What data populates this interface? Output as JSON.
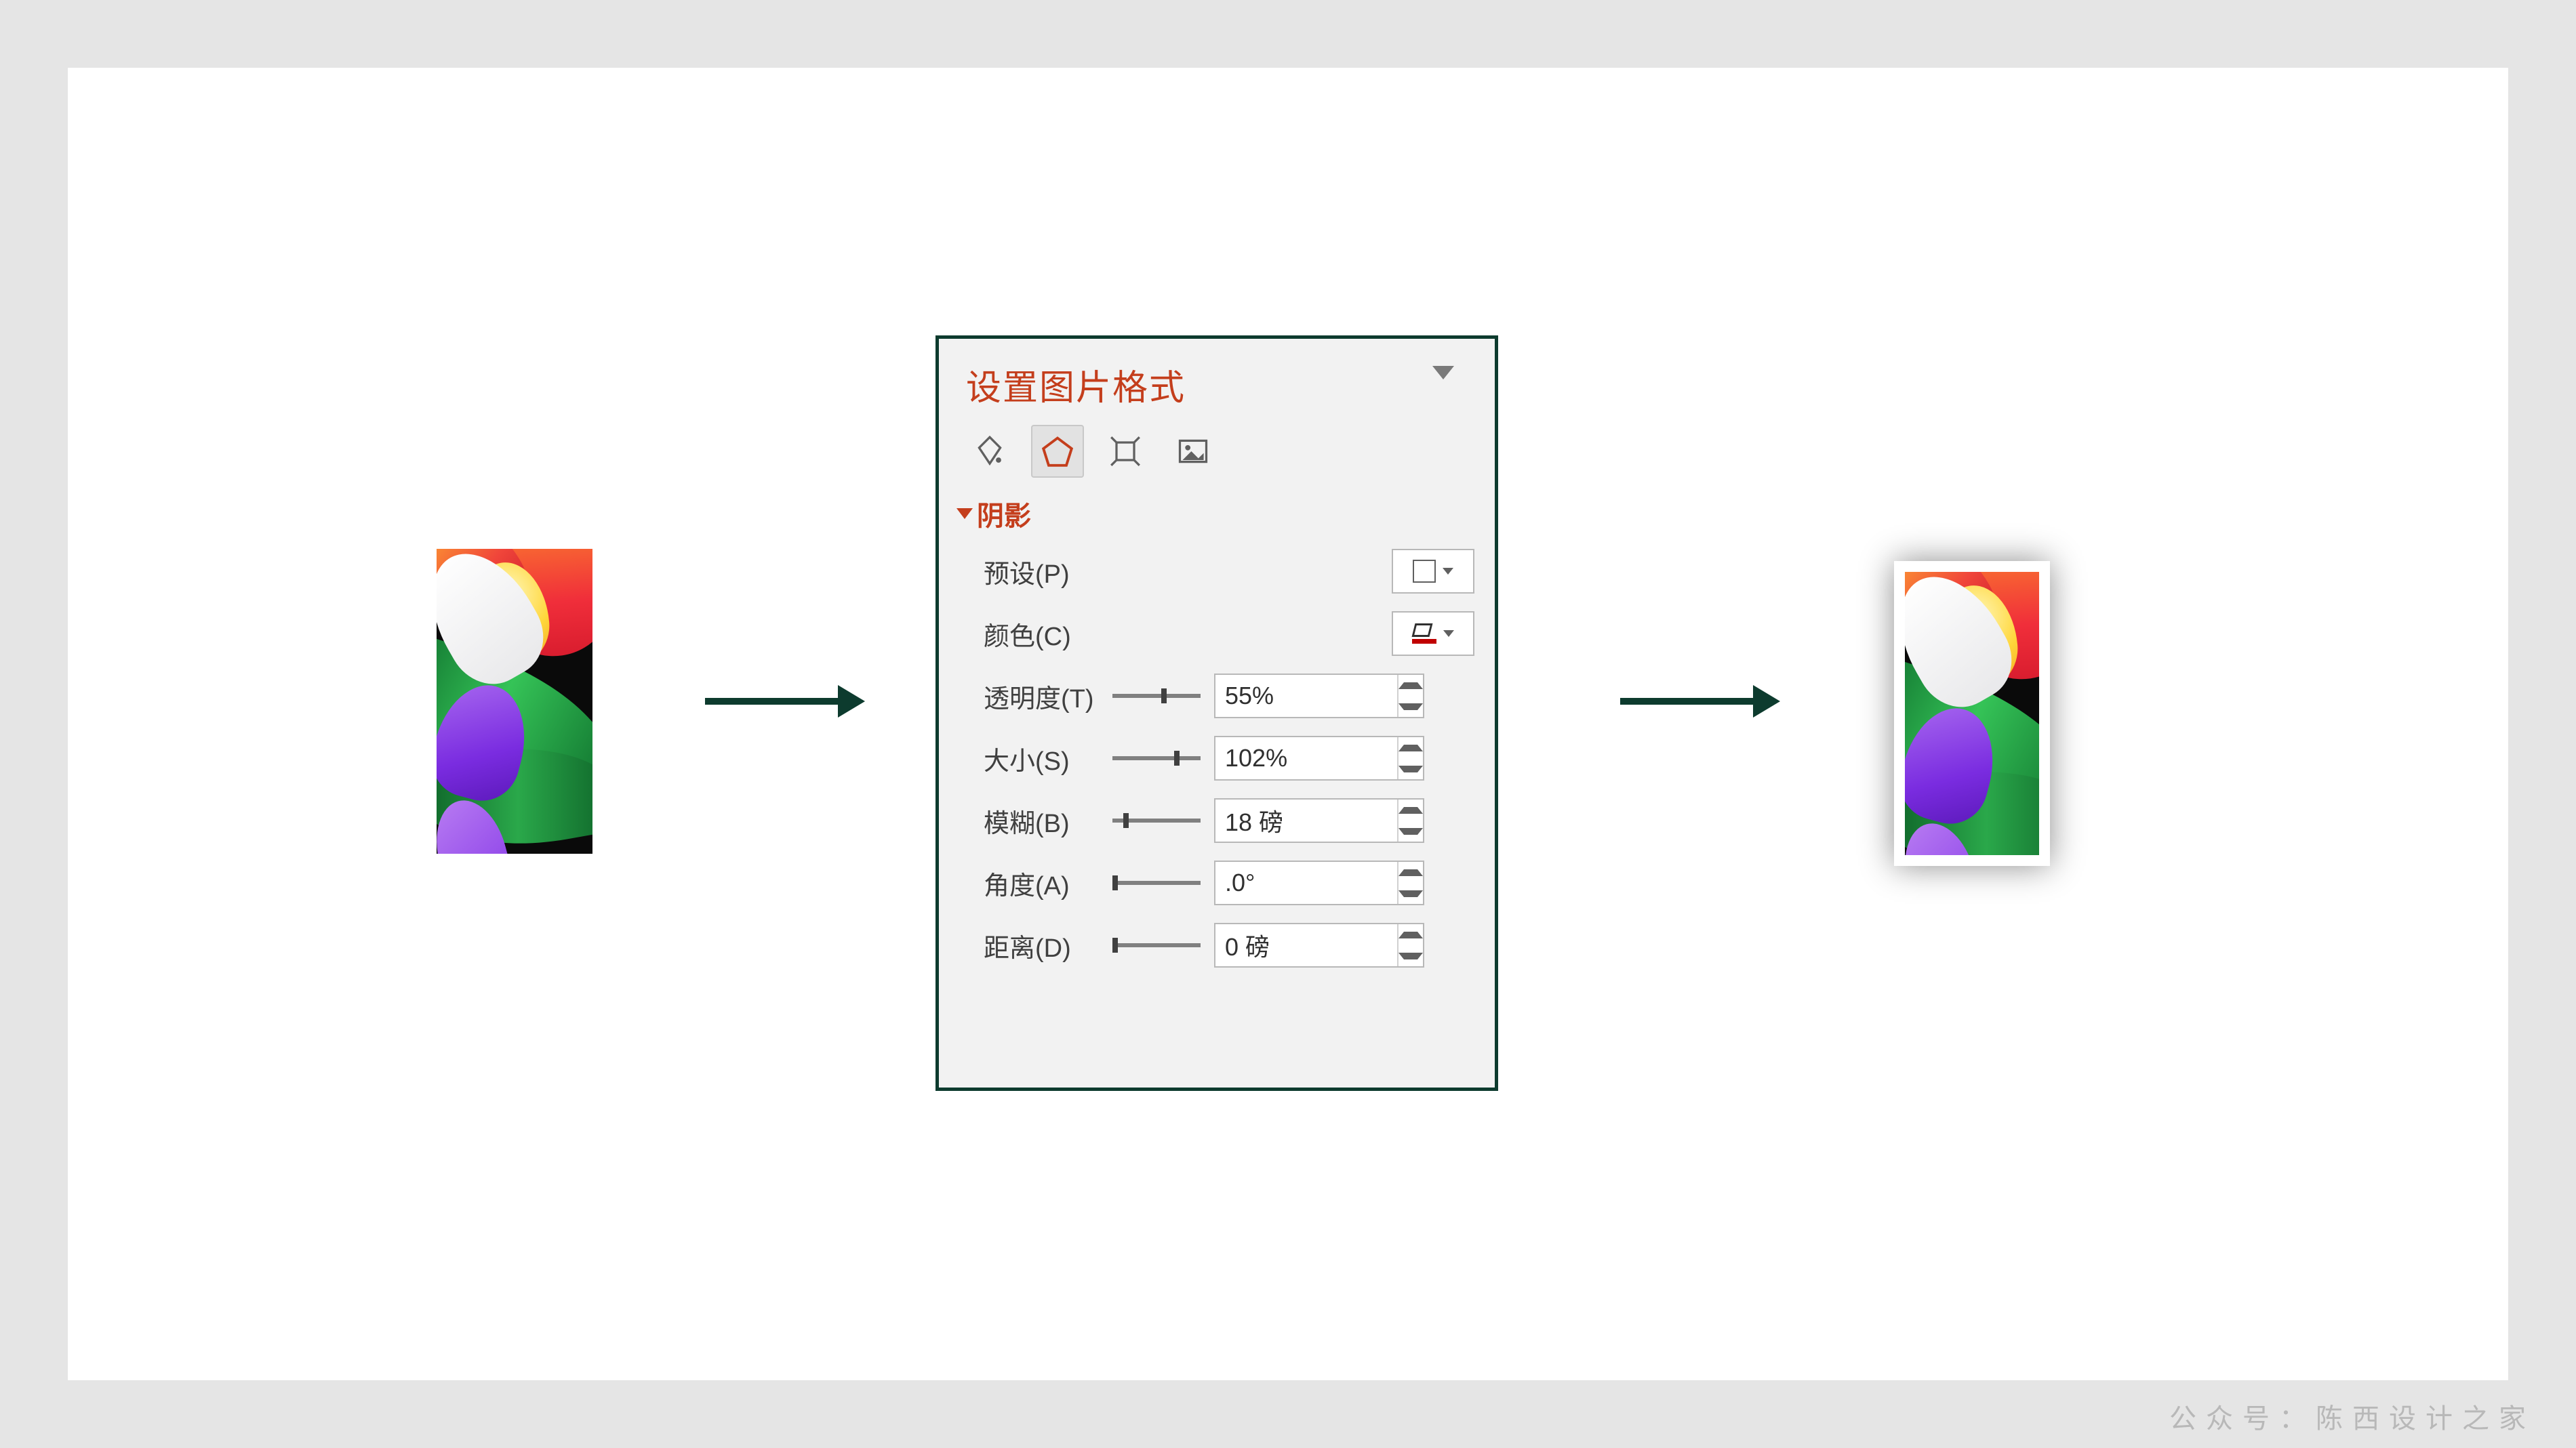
{
  "panel": {
    "title": "设置图片格式",
    "section": "阴影",
    "rows": {
      "preset": {
        "label": "预设(P)"
      },
      "color": {
        "label": "颜色(C)"
      },
      "transparency": {
        "label": "透明度(T)",
        "value": "55%",
        "thumb_pct": 55
      },
      "size": {
        "label": "大小(S)",
        "value": "102%",
        "thumb_pct": 70
      },
      "blur": {
        "label": "模糊(B)",
        "value": "18 磅",
        "thumb_pct": 12
      },
      "angle": {
        "label": "角度(A)",
        "value": ".0°",
        "thumb_pct": 0
      },
      "distance": {
        "label": "距离(D)",
        "value": "0 磅",
        "thumb_pct": 0
      }
    },
    "tabs": [
      "fill-line",
      "effects",
      "size-properties",
      "picture"
    ]
  },
  "watermark": "公众号：陈西设计之家"
}
